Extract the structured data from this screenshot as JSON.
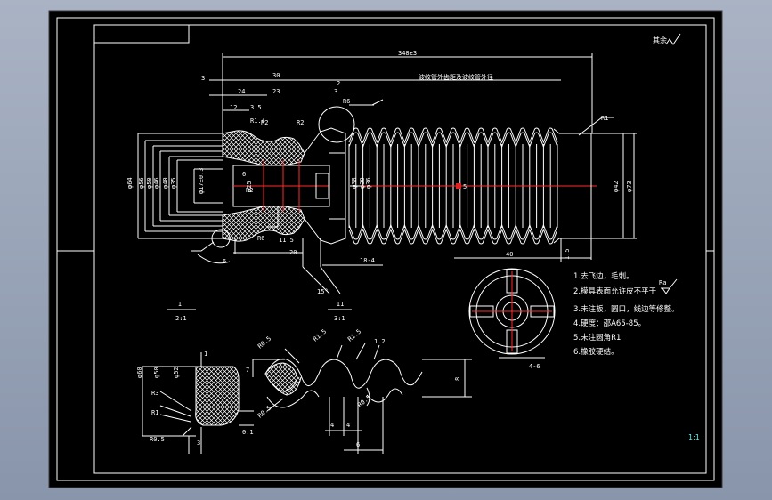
{
  "title_block": {
    "scale_mark": "1:1"
  },
  "surface_mark": {
    "label": "其余"
  },
  "main_view": {
    "overall_length": "348±3",
    "note_title": "波纹管外齿距及波纹管外径",
    "dims_top": [
      "3",
      "30",
      "24",
      "23",
      "12",
      "3.5",
      "R1.4",
      "R2",
      "3",
      "R6",
      "R2"
    ],
    "dims_left": [
      "φ64",
      "φ56",
      "φ50",
      "φ46",
      "φ40",
      "φ35",
      "φ17±0.3"
    ],
    "dims_mid": [
      "6",
      "φ25",
      "R2",
      "R6",
      "11.5",
      "20",
      "18-4",
      "15°",
      "φ30",
      "φ36",
      "φ38"
    ],
    "dims_right": [
      "R1",
      "φ42",
      "φ73",
      "1.5",
      "40",
      "5"
    ],
    "labels": [
      "I",
      "II",
      "6",
      "2"
    ]
  },
  "detail_one": {
    "title": "I",
    "scale": "2:1",
    "dims": [
      "φ60",
      "φ50",
      "φ52",
      "R3",
      "R1",
      "R0.5",
      "0.1",
      "3",
      "1"
    ]
  },
  "detail_two": {
    "title": "II",
    "scale": "3:1",
    "dims": [
      "R0.5",
      "R1.5",
      "R1.5",
      "1.2",
      "R0.5",
      "R0.5",
      "7",
      "4",
      "4",
      "6",
      "8"
    ]
  },
  "section_view": {
    "label": "4-6"
  },
  "notes": [
    "1.去飞边，毛刺。",
    "2.模具表面允许皮不平于",
    "3.未注板，圆口，线边等修整。",
    "4.硬度：邵A65-85。",
    "5.未注圆角R1",
    "6.橡胶硬结。"
  ],
  "roughness_mark": "Ra"
}
